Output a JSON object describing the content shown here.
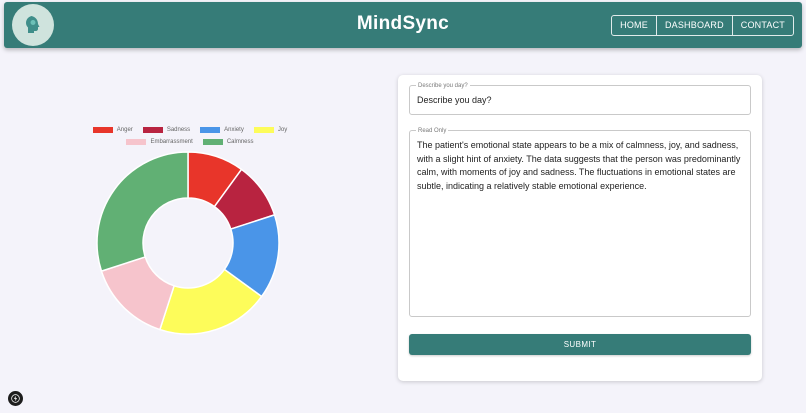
{
  "header": {
    "brand": "MindSync",
    "nav": [
      "HOME",
      "DASHBOARD",
      "CONTACT"
    ],
    "color": "#367c78"
  },
  "chart_data": {
    "type": "pie",
    "donut": true,
    "categories": [
      "Anger",
      "Sadness",
      "Anxiety",
      "Joy",
      "Embarrassment",
      "Calmness"
    ],
    "values": [
      10,
      10,
      15,
      20,
      15,
      30
    ],
    "colors": [
      "#e8352a",
      "#b82340",
      "#4a95e8",
      "#fdfc5a",
      "#f6c4cc",
      "#61b074"
    ],
    "legend_position": "top"
  },
  "form": {
    "input_label": "Describe you day?",
    "input_value": "Describe you day?",
    "readonly_label": "Read Only",
    "readonly_text": "The patient's emotional state appears to be a mix of calmness, joy, and sadness, with a slight hint of anxiety. The data suggests that the person was predominantly calm, with moments of joy and sadness. The fluctuations in emotional states are subtle, indicating a relatively stable emotional experience.",
    "submit_label": "SUBMIT"
  },
  "icons": {
    "logo": "head-profile-icon",
    "fab": "lightning-icon"
  }
}
